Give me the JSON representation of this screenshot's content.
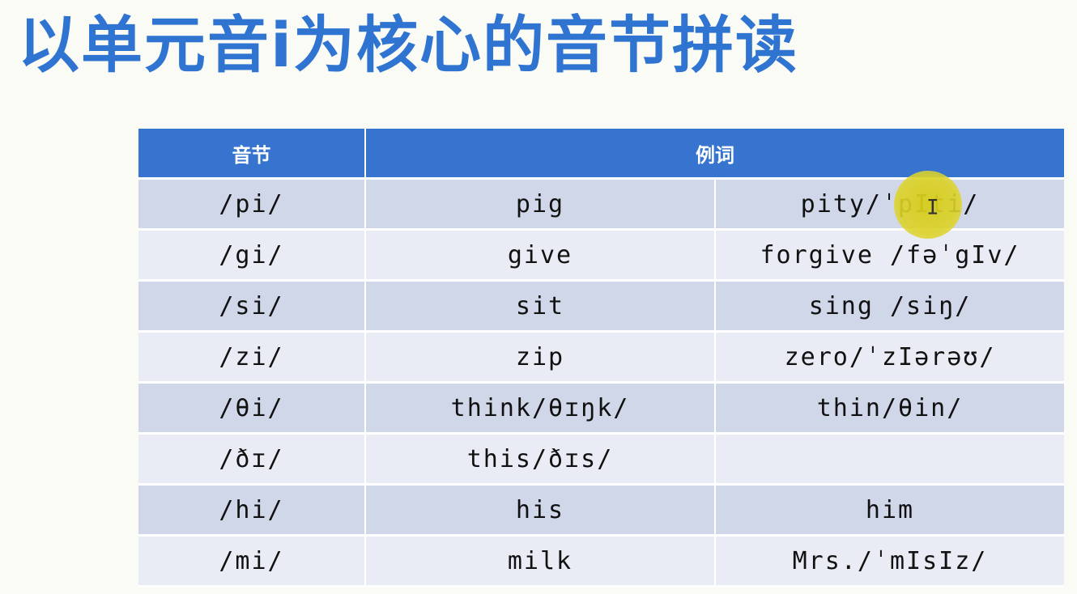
{
  "title": "以单元音i为核心的音节拼读",
  "table": {
    "headers": [
      "音节",
      "例词"
    ],
    "rows": [
      {
        "syllable": "/pi/",
        "word1": "pig",
        "word2": "pity/ˈpIti/"
      },
      {
        "syllable": "/gi/",
        "word1": "give",
        "word2": "forgive /fəˈgIv/"
      },
      {
        "syllable": "/si/",
        "word1": "sit",
        "word2": "sing /siŋ/"
      },
      {
        "syllable": "/zi/",
        "word1": "zip",
        "word2": "zero/ˈzIərəʊ/"
      },
      {
        "syllable": "/θi/",
        "word1": "think/θɪŋk/",
        "word2": "thin/θin/"
      },
      {
        "syllable": "/ðɪ/",
        "word1": "this/ðɪs/",
        "word2": ""
      },
      {
        "syllable": "/hi/",
        "word1": "his",
        "word2": "him"
      },
      {
        "syllable": "/mi/",
        "word1": "milk",
        "word2": "Mrs./ˈmIsIz/"
      }
    ]
  },
  "overlay": {
    "cursor_icon": "text-cursor-icon",
    "highlight_color": "#d6cc19"
  }
}
